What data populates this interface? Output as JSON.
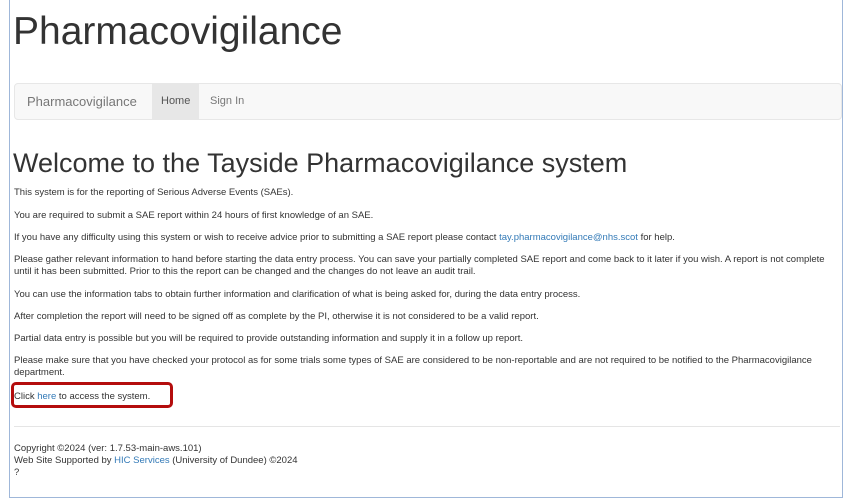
{
  "header": {
    "title": "Pharmacovigilance"
  },
  "navbar": {
    "brand": "Pharmacovigilance",
    "items": [
      {
        "label": "Home",
        "active": true
      },
      {
        "label": "Sign In",
        "active": false
      }
    ]
  },
  "main": {
    "heading": "Welcome to the Tayside Pharmacovigilance system",
    "paragraphs": [
      "This system is for the reporting of Serious Adverse Events (SAEs).",
      "You are required to submit a SAE report within 24 hours of first knowledge of an SAE."
    ],
    "contact": {
      "before": "If you have any difficulty using this system or wish to receive advice prior to submitting a SAE report please contact ",
      "email": "tay.pharmacovigilance@nhs.scot",
      "after": " for help."
    },
    "paragraphs2": [
      "Please gather relevant information to hand before starting the data entry process. You can save your partially completed SAE report and come back to it later if you wish. A report is not complete until it has been submitted. Prior to this the report can be changed and the changes do not leave an audit trail.",
      "You can use the information tabs to obtain further information and clarification of what is being asked for, during the data entry process.",
      "After completion the report will need to be signed off as complete by the PI, otherwise it is not considered to be a valid report.",
      "Partial data entry is possible but you will be required to provide outstanding information and supply it in a follow up report.",
      "Please make sure that you have checked your protocol as for some trials some types of SAE are considered to be non-reportable and are not required to be notified to the Pharmacovigilance department."
    ],
    "access": {
      "before": "Click ",
      "link": "here",
      "after": " to access the system."
    }
  },
  "footer": {
    "copyright": "Copyright ©2024 (ver: 1.7.53-main-aws.101)",
    "supported_before": "Web Site Supported by ",
    "supported_link": "HIC Services",
    "supported_after": " (University of Dundee) ©2024",
    "extra": "?"
  },
  "colors": {
    "link": "#337ab7",
    "highlight": "#b40d0d",
    "frame": "#9fb7d9"
  }
}
